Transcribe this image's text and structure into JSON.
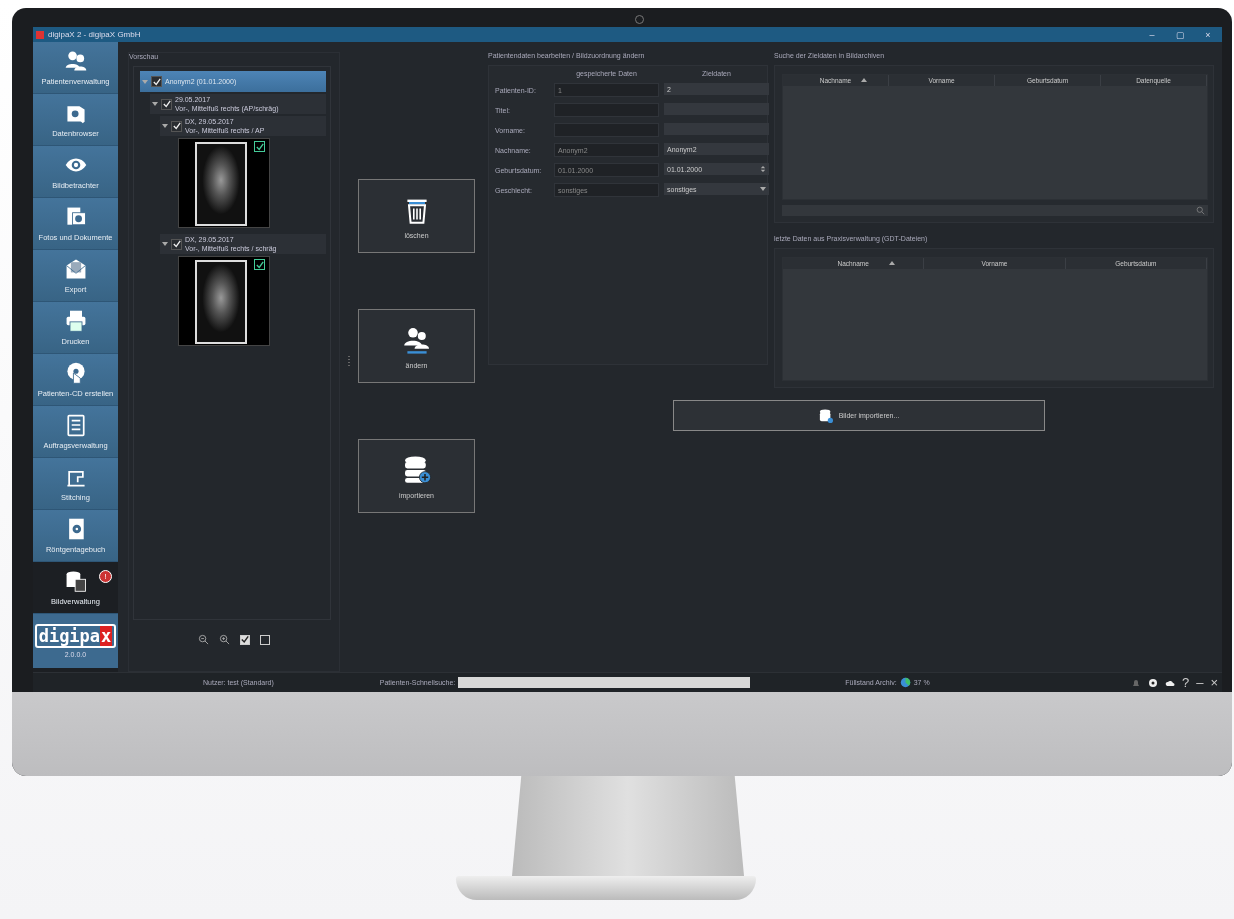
{
  "window": {
    "title": "digipaX 2 - digipaX GmbH",
    "controls": [
      "–",
      "▢",
      "×"
    ]
  },
  "sidebar": {
    "items": [
      {
        "label": "Patientenverwaltung",
        "selected": false
      },
      {
        "label": "Datenbrowser",
        "selected": false
      },
      {
        "label": "Bildbetrachter",
        "selected": false
      },
      {
        "label": "Fotos und Dokumente",
        "selected": false
      },
      {
        "label": "Export",
        "selected": false
      },
      {
        "label": "Drucken",
        "selected": false
      },
      {
        "label": "Patienten-CD erstellen",
        "selected": false
      },
      {
        "label": "Auftragsverwaltung",
        "selected": false
      },
      {
        "label": "Stitching",
        "selected": false
      },
      {
        "label": "Röntgentagebuch",
        "selected": false
      },
      {
        "label": "Bildverwaltung",
        "selected": true,
        "badge": "!"
      }
    ],
    "logo": {
      "name": "digipa",
      "mark": "x",
      "version": "2.0.0.0"
    }
  },
  "preview": {
    "title": "Vorschau",
    "tree": [
      {
        "lines": [
          "Anonym2 (01.01.2000)"
        ],
        "checked": true,
        "selected": true,
        "expanded": true,
        "children": [
          {
            "lines": [
              "29.05.2017",
              "Vor-, Mittelfuß rechts (AP/schräg)"
            ],
            "checked": true,
            "selected": false,
            "expanded": true,
            "children": [
              {
                "lines": [
                  "DX, 29.05.2017",
                  "Vor-, Mittelfuß rechts / AP"
                ],
                "checked": true,
                "selected": false,
                "expanded": true,
                "image_checked": true
              },
              {
                "lines": [
                  "DX, 29.05.2017",
                  "Vor-, Mittelfuß rechts / schräg"
                ],
                "checked": true,
                "selected": false,
                "expanded": true,
                "image_checked": true
              }
            ]
          }
        ]
      }
    ],
    "toolbar": [
      {
        "kind": "zoom-out"
      },
      {
        "kind": "zoom-in"
      },
      {
        "kind": "check",
        "checked": true
      },
      {
        "kind": "check",
        "checked": false
      }
    ]
  },
  "actions": [
    {
      "label": "löschen",
      "kind": "trash"
    },
    {
      "label": "ändern",
      "kind": "users"
    },
    {
      "label": "importieren",
      "kind": "database"
    }
  ],
  "form": {
    "title": "Patientendaten bearbeiten / Bildzuordnung ändern",
    "columns": [
      "gespeicherte Daten",
      "Zieldaten"
    ],
    "rows": [
      {
        "label": "Patienten-ID:",
        "stored": "1",
        "target": "2",
        "kind": "text"
      },
      {
        "label": "Titel:",
        "stored": "",
        "target": "",
        "kind": "text"
      },
      {
        "label": "Vorname:",
        "stored": "",
        "target": "",
        "kind": "text"
      },
      {
        "label": "Nachname:",
        "stored": "Anonym2",
        "target": "Anonym2",
        "kind": "text"
      },
      {
        "label": "Geburtsdatum:",
        "stored": "01.01.2000",
        "target": "01.01.2000",
        "kind": "spin"
      },
      {
        "label": "Geschlecht:",
        "stored": "sonstiges",
        "target": "sonstiges",
        "kind": "select"
      }
    ]
  },
  "archive_search": {
    "title": "Suche der Zieldaten in Bildarchiven",
    "columns": [
      "Nachname",
      "Vorname",
      "Geburtsdatum",
      "Datenquelle"
    ]
  },
  "gdt": {
    "title": "letzte Daten aus Praxisverwaltung (GDT-Dateien)",
    "columns": [
      "Nachname",
      "Vorname",
      "Geburtsdatum"
    ]
  },
  "import_button": {
    "label": "Bilder importieren..."
  },
  "status_bar": {
    "user": "Nutzer: test (Standard)",
    "quick_search_label": "Patienten-Schnellsuche:",
    "archive_label": "Füllstand Archiv:",
    "archive_reading": "37 %",
    "controls": [
      "?",
      "–",
      "×"
    ]
  }
}
